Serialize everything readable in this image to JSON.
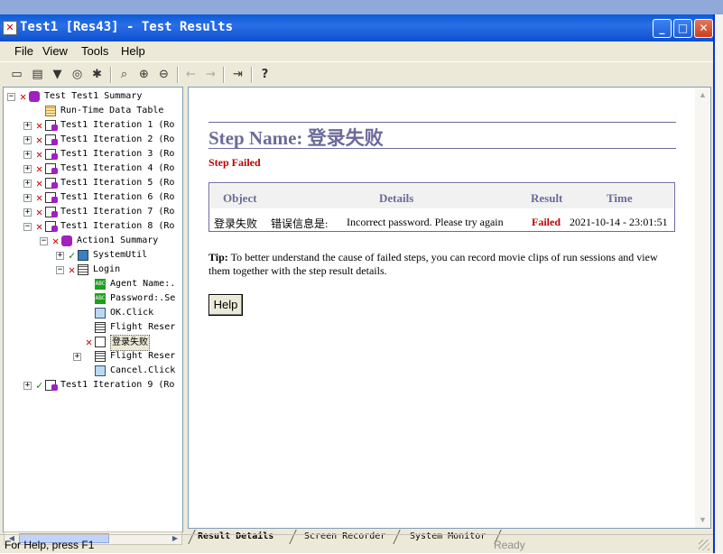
{
  "window": {
    "title": "Test1 [Res43] - Test Results",
    "controls": {
      "minimize": "_",
      "maximize": "□",
      "close": "✕"
    }
  },
  "menu": {
    "items": [
      "File",
      "View",
      "Tools",
      "Help"
    ]
  },
  "toolbar": {
    "icons": [
      "open-folder-icon",
      "print-icon",
      "filter-icon",
      "find-icon",
      "bug-icon",
      "zoom-icon",
      "zoom-in-icon",
      "zoom-out-icon",
      "arrow-left-icon",
      "arrow-right-icon",
      "jump-icon",
      "help-icon"
    ],
    "help_glyph": "?"
  },
  "tree": {
    "nodes": [
      {
        "label": "Test Test1 Summary",
        "status": "fail",
        "icon": "summary-icon"
      },
      {
        "label": "Run-Time Data Table",
        "status": "none",
        "icon": "table-icon"
      },
      {
        "label": "Test1 Iteration 1 (Ro",
        "status": "fail",
        "icon": "iteration-icon"
      },
      {
        "label": "Test1 Iteration 2 (Ro",
        "status": "fail",
        "icon": "iteration-icon"
      },
      {
        "label": "Test1 Iteration 3 (Ro",
        "status": "fail",
        "icon": "iteration-icon"
      },
      {
        "label": "Test1 Iteration 4 (Ro",
        "status": "fail",
        "icon": "iteration-icon"
      },
      {
        "label": "Test1 Iteration 5 (Ro",
        "status": "fail",
        "icon": "iteration-icon"
      },
      {
        "label": "Test1 Iteration 6 (Ro",
        "status": "fail",
        "icon": "iteration-icon"
      },
      {
        "label": "Test1 Iteration 7 (Ro",
        "status": "fail",
        "icon": "iteration-icon"
      },
      {
        "label": "Test1 Iteration 8 (Ro",
        "status": "fail",
        "icon": "iteration-icon"
      },
      {
        "label": "Action1 Summary",
        "status": "fail",
        "icon": "summary-icon"
      },
      {
        "label": "SystemUtil",
        "status": "pass",
        "icon": "util-icon"
      },
      {
        "label": "Login",
        "status": "fail",
        "icon": "window-icon"
      },
      {
        "label": "Agent Name:.",
        "status": "none",
        "icon": "textbox-icon"
      },
      {
        "label": "Password:.Se",
        "status": "none",
        "icon": "textbox-icon"
      },
      {
        "label": "OK.Click",
        "status": "none",
        "icon": "button-icon"
      },
      {
        "label": "Flight Reser",
        "status": "none",
        "icon": "window-icon"
      },
      {
        "label": "登录失败",
        "status": "fail",
        "icon": "checkpoint-icon"
      },
      {
        "label": "Flight Reser",
        "status": "none",
        "icon": "window-icon"
      },
      {
        "label": "Cancel.Click",
        "status": "none",
        "icon": "button-icon"
      },
      {
        "label": "Test1 Iteration 9 (Ro",
        "status": "pass",
        "icon": "iteration-icon"
      }
    ]
  },
  "detail": {
    "step_name": "Step Name: 登录失败",
    "status": "Step Failed",
    "table": {
      "headers": [
        "Object",
        "Details",
        "Result",
        "Time"
      ],
      "row": {
        "object": "登录失败",
        "details_label": "错误信息是:",
        "details_value": "Incorrect password. Please try again",
        "result": "Failed",
        "time": "2021-10-14 - 23:01:51"
      }
    },
    "tip_label": "Tip:",
    "tip_text": "To better understand the cause of failed steps, you can record movie clips of run sessions and view them together with the step result details.",
    "help_button": "Help"
  },
  "tabs": [
    "Result Details",
    "Screen Recorder",
    "System Monitor"
  ],
  "statusbar": {
    "left": "For Help, press F1",
    "right": "Ready"
  },
  "colors": {
    "fail": "#c00000",
    "pass": "#108010",
    "heading": "#6b6b9b",
    "titlebar": "#0a5bd8"
  }
}
